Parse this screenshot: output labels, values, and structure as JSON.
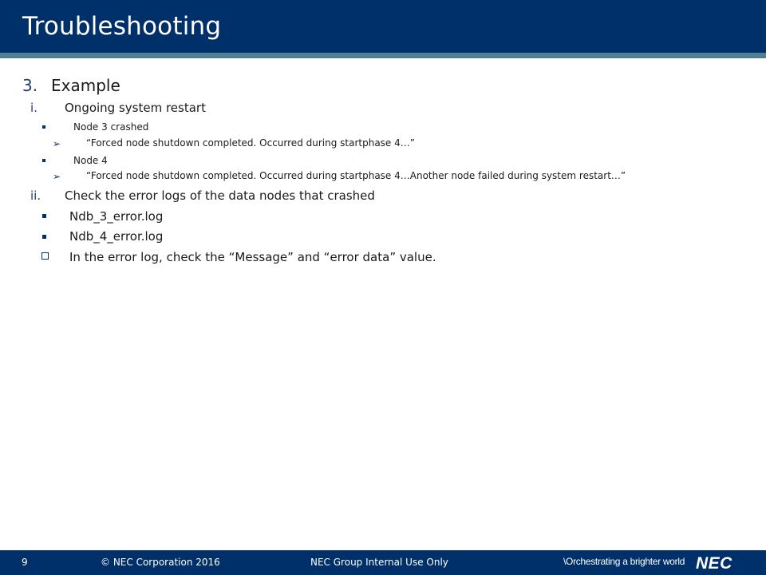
{
  "slide": {
    "title": "Troubleshooting"
  },
  "section": {
    "number": "3.",
    "heading": "Example"
  },
  "items": [
    {
      "marker": "i.",
      "text": "Ongoing system restart",
      "sub": [
        {
          "text": "Node 3 crashed",
          "quote": "“Forced node shutdown completed. Occurred during startphase 4…”"
        },
        {
          "text": "Node 4",
          "quote": "“Forced node shutdown completed. Occurred during startphase 4…Another node failed during system restart…”"
        }
      ]
    },
    {
      "marker": "ii.",
      "text": "Check the error logs of the data nodes that crashed",
      "logs": [
        "Ndb_3_error.log",
        "Ndb_4_error.log"
      ],
      "note": "In the error log, check the “Message” and “error data” value."
    }
  ],
  "footer": {
    "page_number": "9",
    "copyright": "© NEC Corporation 2016",
    "classification": "NEC Group Internal Use Only",
    "tagline": "\\Orchestrating a brighter world",
    "logo": "NEC"
  },
  "colors": {
    "brand_navy": "#00306a",
    "stripe": "#4f7f95",
    "number_blue": "#1f3c7a"
  }
}
